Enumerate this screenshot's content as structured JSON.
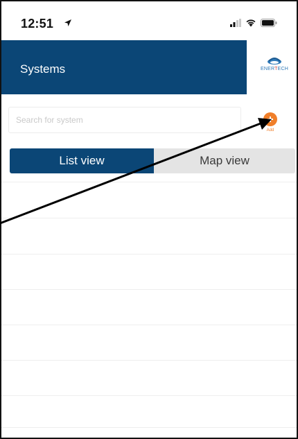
{
  "status_bar": {
    "time": "12:51",
    "icons": [
      "location-arrow-icon",
      "cellular-signal-icon",
      "wifi-icon",
      "battery-icon"
    ]
  },
  "header": {
    "title": "Systems",
    "logo": {
      "text_blue_1": "ENER",
      "text_red": "T",
      "text_blue_2": "ECH"
    }
  },
  "search": {
    "placeholder": "Search for system",
    "value": ""
  },
  "add_button": {
    "label": "Add"
  },
  "view_toggle": {
    "options": [
      "List view",
      "Map view"
    ],
    "selected": "List view"
  },
  "list": {
    "rows": 7
  },
  "colors": {
    "primary": "#0b4676",
    "accent": "#f07f2a",
    "toggle_inactive": "#e4e4e4"
  }
}
